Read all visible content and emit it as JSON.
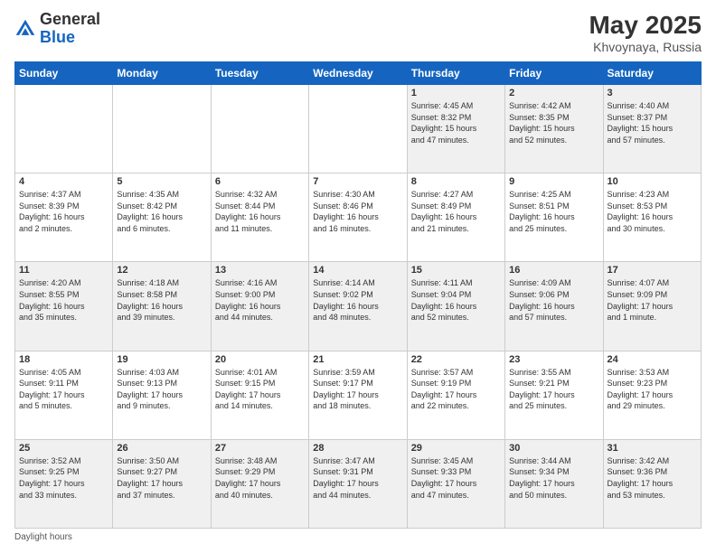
{
  "header": {
    "logo_general": "General",
    "logo_blue": "Blue",
    "title": "May 2025",
    "location": "Khvoynaya, Russia"
  },
  "days_of_week": [
    "Sunday",
    "Monday",
    "Tuesday",
    "Wednesday",
    "Thursday",
    "Friday",
    "Saturday"
  ],
  "footer": {
    "note": "Daylight hours"
  },
  "weeks": [
    {
      "days": [
        {
          "date": "",
          "info": ""
        },
        {
          "date": "",
          "info": ""
        },
        {
          "date": "",
          "info": ""
        },
        {
          "date": "",
          "info": ""
        },
        {
          "date": "1",
          "info": "Sunrise: 4:45 AM\nSunset: 8:32 PM\nDaylight: 15 hours\nand 47 minutes."
        },
        {
          "date": "2",
          "info": "Sunrise: 4:42 AM\nSunset: 8:35 PM\nDaylight: 15 hours\nand 52 minutes."
        },
        {
          "date": "3",
          "info": "Sunrise: 4:40 AM\nSunset: 8:37 PM\nDaylight: 15 hours\nand 57 minutes."
        }
      ]
    },
    {
      "days": [
        {
          "date": "4",
          "info": "Sunrise: 4:37 AM\nSunset: 8:39 PM\nDaylight: 16 hours\nand 2 minutes."
        },
        {
          "date": "5",
          "info": "Sunrise: 4:35 AM\nSunset: 8:42 PM\nDaylight: 16 hours\nand 6 minutes."
        },
        {
          "date": "6",
          "info": "Sunrise: 4:32 AM\nSunset: 8:44 PM\nDaylight: 16 hours\nand 11 minutes."
        },
        {
          "date": "7",
          "info": "Sunrise: 4:30 AM\nSunset: 8:46 PM\nDaylight: 16 hours\nand 16 minutes."
        },
        {
          "date": "8",
          "info": "Sunrise: 4:27 AM\nSunset: 8:49 PM\nDaylight: 16 hours\nand 21 minutes."
        },
        {
          "date": "9",
          "info": "Sunrise: 4:25 AM\nSunset: 8:51 PM\nDaylight: 16 hours\nand 25 minutes."
        },
        {
          "date": "10",
          "info": "Sunrise: 4:23 AM\nSunset: 8:53 PM\nDaylight: 16 hours\nand 30 minutes."
        }
      ]
    },
    {
      "days": [
        {
          "date": "11",
          "info": "Sunrise: 4:20 AM\nSunset: 8:55 PM\nDaylight: 16 hours\nand 35 minutes."
        },
        {
          "date": "12",
          "info": "Sunrise: 4:18 AM\nSunset: 8:58 PM\nDaylight: 16 hours\nand 39 minutes."
        },
        {
          "date": "13",
          "info": "Sunrise: 4:16 AM\nSunset: 9:00 PM\nDaylight: 16 hours\nand 44 minutes."
        },
        {
          "date": "14",
          "info": "Sunrise: 4:14 AM\nSunset: 9:02 PM\nDaylight: 16 hours\nand 48 minutes."
        },
        {
          "date": "15",
          "info": "Sunrise: 4:11 AM\nSunset: 9:04 PM\nDaylight: 16 hours\nand 52 minutes."
        },
        {
          "date": "16",
          "info": "Sunrise: 4:09 AM\nSunset: 9:06 PM\nDaylight: 16 hours\nand 57 minutes."
        },
        {
          "date": "17",
          "info": "Sunrise: 4:07 AM\nSunset: 9:09 PM\nDaylight: 17 hours\nand 1 minute."
        }
      ]
    },
    {
      "days": [
        {
          "date": "18",
          "info": "Sunrise: 4:05 AM\nSunset: 9:11 PM\nDaylight: 17 hours\nand 5 minutes."
        },
        {
          "date": "19",
          "info": "Sunrise: 4:03 AM\nSunset: 9:13 PM\nDaylight: 17 hours\nand 9 minutes."
        },
        {
          "date": "20",
          "info": "Sunrise: 4:01 AM\nSunset: 9:15 PM\nDaylight: 17 hours\nand 14 minutes."
        },
        {
          "date": "21",
          "info": "Sunrise: 3:59 AM\nSunset: 9:17 PM\nDaylight: 17 hours\nand 18 minutes."
        },
        {
          "date": "22",
          "info": "Sunrise: 3:57 AM\nSunset: 9:19 PM\nDaylight: 17 hours\nand 22 minutes."
        },
        {
          "date": "23",
          "info": "Sunrise: 3:55 AM\nSunset: 9:21 PM\nDaylight: 17 hours\nand 25 minutes."
        },
        {
          "date": "24",
          "info": "Sunrise: 3:53 AM\nSunset: 9:23 PM\nDaylight: 17 hours\nand 29 minutes."
        }
      ]
    },
    {
      "days": [
        {
          "date": "25",
          "info": "Sunrise: 3:52 AM\nSunset: 9:25 PM\nDaylight: 17 hours\nand 33 minutes."
        },
        {
          "date": "26",
          "info": "Sunrise: 3:50 AM\nSunset: 9:27 PM\nDaylight: 17 hours\nand 37 minutes."
        },
        {
          "date": "27",
          "info": "Sunrise: 3:48 AM\nSunset: 9:29 PM\nDaylight: 17 hours\nand 40 minutes."
        },
        {
          "date": "28",
          "info": "Sunrise: 3:47 AM\nSunset: 9:31 PM\nDaylight: 17 hours\nand 44 minutes."
        },
        {
          "date": "29",
          "info": "Sunrise: 3:45 AM\nSunset: 9:33 PM\nDaylight: 17 hours\nand 47 minutes."
        },
        {
          "date": "30",
          "info": "Sunrise: 3:44 AM\nSunset: 9:34 PM\nDaylight: 17 hours\nand 50 minutes."
        },
        {
          "date": "31",
          "info": "Sunrise: 3:42 AM\nSunset: 9:36 PM\nDaylight: 17 hours\nand 53 minutes."
        }
      ]
    }
  ]
}
